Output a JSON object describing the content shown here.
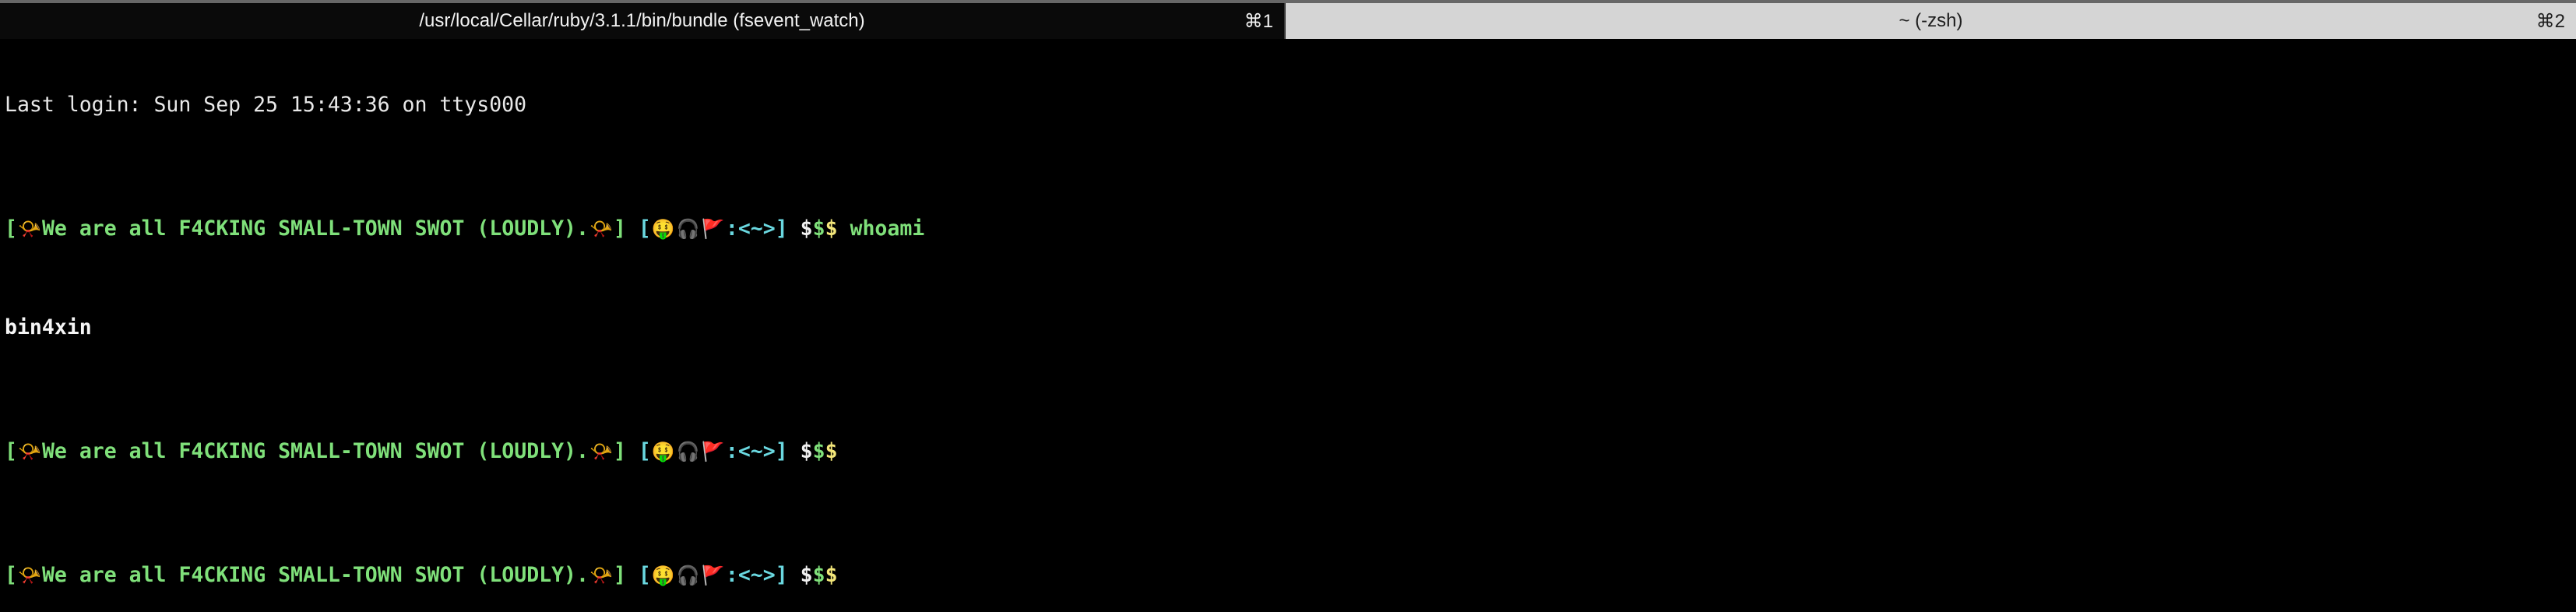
{
  "window": {
    "tabs": [
      {
        "title": "/usr/local/Cellar/ruby/3.1.1/bin/bundle (fsevent_watch)",
        "shortcut": "⌘1",
        "active": true
      },
      {
        "title": "~ (-zsh)",
        "shortcut": "⌘2",
        "active": false
      }
    ]
  },
  "terminal": {
    "last_login": "Last login: Sun Sep 25 15:43:36 on ttys000",
    "prompt": {
      "open_bracket_1": "[",
      "megaphone_icon": "📯",
      "motto": "We are all F4CKING SMALL-TOWN SWOT (LOUDLY).",
      "close_bracket_1": "]",
      "open_bracket_2": "[",
      "money_face_icon": "🤑",
      "headphones_icon": "🎧",
      "flag_icon": "🚩",
      "path": ":<~>",
      "close_bracket_2": "]",
      "dollar_1": "$",
      "dollar_2": "$",
      "dollar_3": "$"
    },
    "lines": [
      {
        "command": "whoami",
        "output": "bin4xin"
      },
      {
        "command": "",
        "output": ""
      },
      {
        "command": "",
        "output": ""
      }
    ]
  }
}
